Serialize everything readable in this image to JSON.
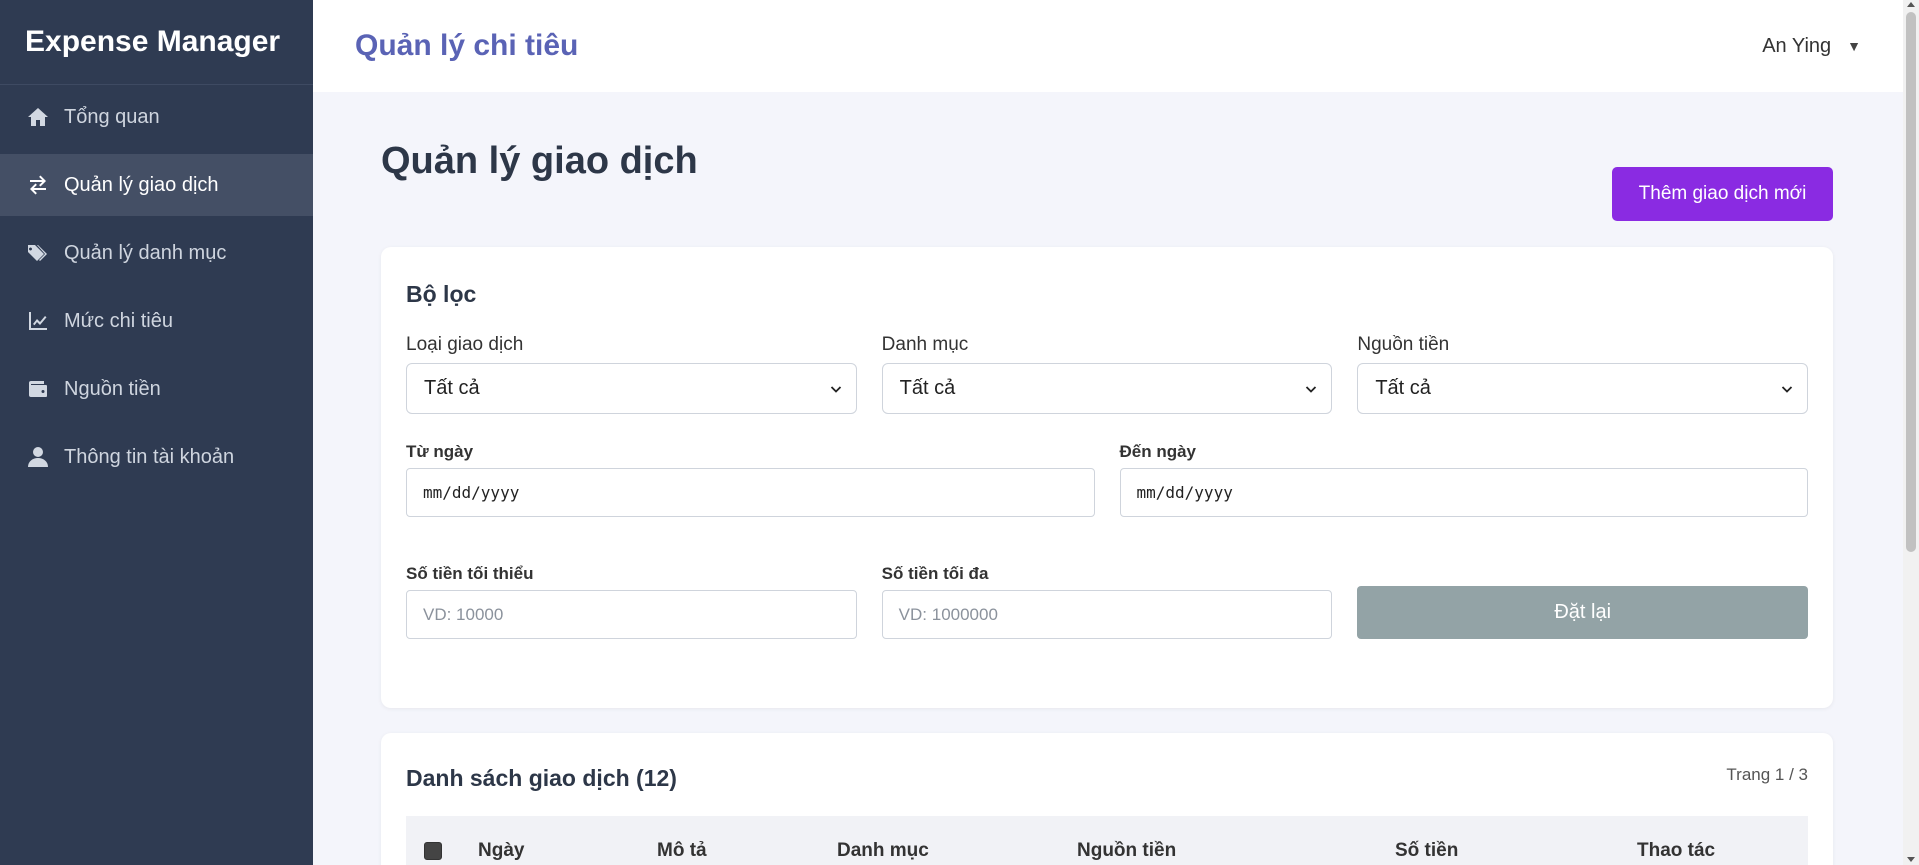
{
  "sidebar": {
    "brand": "Expense Manager",
    "items": [
      {
        "label": "Tổng quan",
        "icon": "home-icon"
      },
      {
        "label": "Quản lý giao dịch",
        "icon": "exchange-icon",
        "active": true
      },
      {
        "label": "Quản lý danh mục",
        "icon": "tags-icon"
      },
      {
        "label": "Mức chi tiêu",
        "icon": "line-chart-icon"
      },
      {
        "label": "Nguồn tiền",
        "icon": "wallet-icon"
      },
      {
        "label": "Thông tin tài khoản",
        "icon": "user-icon"
      }
    ]
  },
  "topbar": {
    "title": "Quản lý chi tiêu",
    "user_name": "An Ying",
    "user_caret": "▼"
  },
  "page": {
    "title": "Quản lý giao dịch",
    "add_button": "Thêm giao dịch mới"
  },
  "filters": {
    "title": "Bộ lọc",
    "type": {
      "label": "Loại giao dịch",
      "value": "Tất cả"
    },
    "category": {
      "label": "Danh mục",
      "value": "Tất cả"
    },
    "source": {
      "label": "Nguồn tiền",
      "value": "Tất cả"
    },
    "from_date": {
      "label": "Từ ngày",
      "value": "mm/dd/yyyy"
    },
    "to_date": {
      "label": "Đến ngày",
      "value": "mm/dd/yyyy"
    },
    "min_amount": {
      "label": "Số tiền tối thiểu",
      "placeholder": "VD: 10000"
    },
    "max_amount": {
      "label": "Số tiền tối đa",
      "placeholder": "VD: 1000000"
    },
    "reset_button": "Đặt lại"
  },
  "transactions": {
    "title": "Danh sách giao dịch (12)",
    "page_indicator": "Trang 1 / 3",
    "columns": [
      "Ngày",
      "Mô tả",
      "Danh mục",
      "Nguồn tiền",
      "Số tiền",
      "Thao tác"
    ]
  },
  "colors": {
    "sidebar_bg": "#2f3b52",
    "accent": "#8a2be2",
    "topbar_title": "#5a63b5",
    "reset_button": "#93a3a6"
  }
}
